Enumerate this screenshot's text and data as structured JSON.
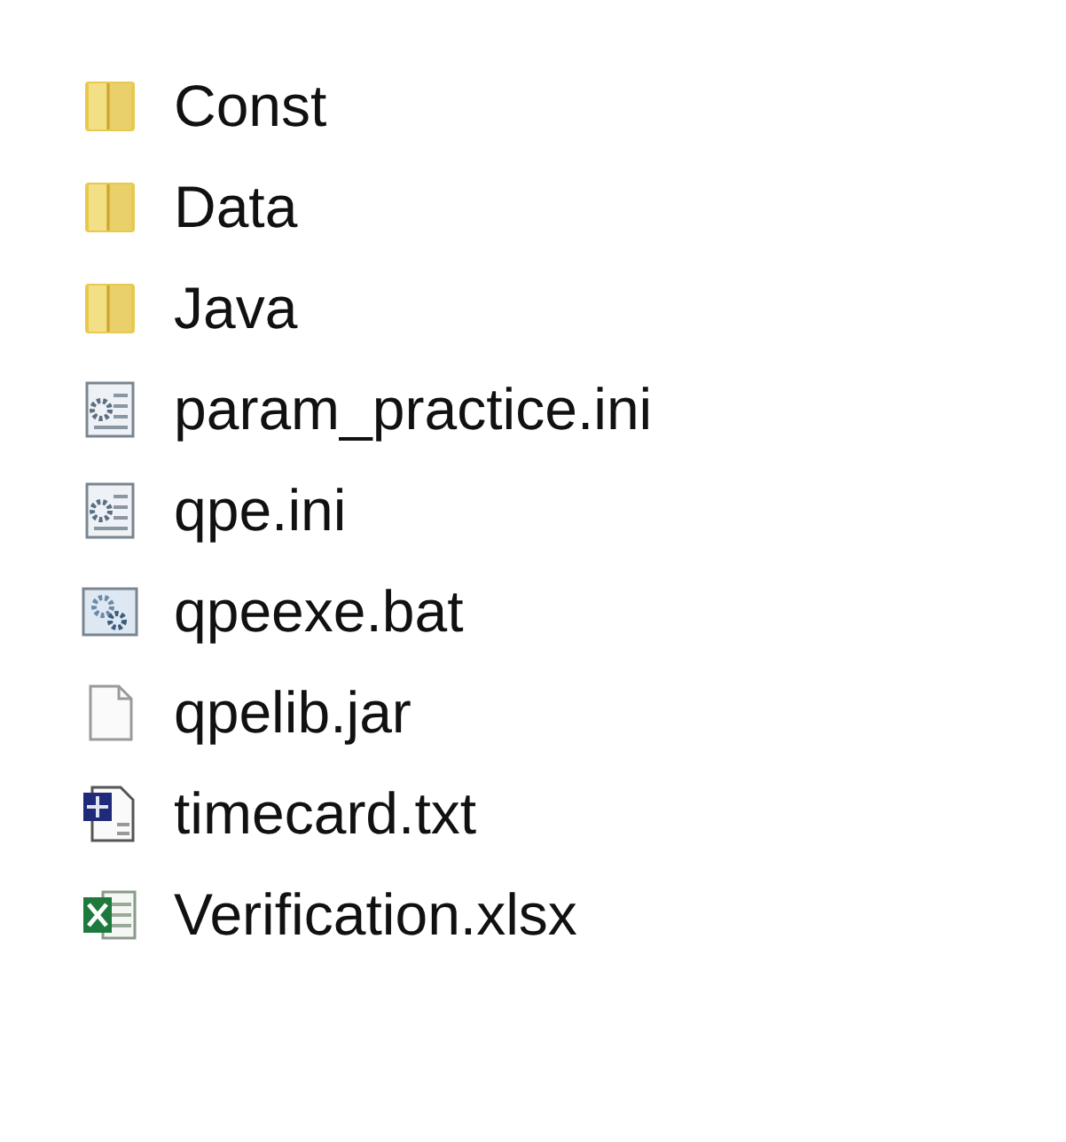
{
  "files": [
    {
      "name": "Const",
      "kind": "folder"
    },
    {
      "name": "Data",
      "kind": "folder"
    },
    {
      "name": "Java",
      "kind": "folder"
    },
    {
      "name": "param_practice.ini",
      "kind": "settings"
    },
    {
      "name": "qpe.ini",
      "kind": "settings"
    },
    {
      "name": "qpeexe.bat",
      "kind": "batch"
    },
    {
      "name": "qpelib.jar",
      "kind": "blank"
    },
    {
      "name": "timecard.txt",
      "kind": "text"
    },
    {
      "name": "Verification.xlsx",
      "kind": "spreadsheet"
    }
  ]
}
